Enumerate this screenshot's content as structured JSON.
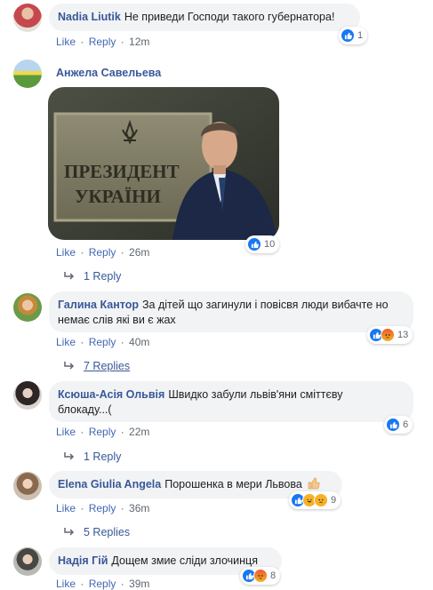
{
  "comments": [
    {
      "author": "Nadia Liutik",
      "text": "Не приведи Господи такого губернатора!",
      "actions": {
        "like": "Like",
        "reply": "Reply",
        "time": "12m"
      },
      "reaction_count": "1"
    },
    {
      "author": "Анжела Савельева",
      "image_text_line1": "ПРЕЗИДЕНТ",
      "image_text_line2": "УКРАЇНИ",
      "actions": {
        "like": "Like",
        "reply": "Reply",
        "time": "26m"
      },
      "reaction_count": "10",
      "replies_label": "1 Reply"
    },
    {
      "author": "Галина Кантор",
      "text": "За дітей що загинули і повісвя люди вибачте но немає слів які ви є жах",
      "actions": {
        "like": "Like",
        "reply": "Reply",
        "time": "40m"
      },
      "reaction_count": "13",
      "replies_label": "7 Replies"
    },
    {
      "author": "Ксюша-Асія Ольвія",
      "text": "Швидко забули львів'яни сміттєву блокаду...(",
      "actions": {
        "like": "Like",
        "reply": "Reply",
        "time": "22m"
      },
      "reaction_count": "6",
      "replies_label": "1 Reply"
    },
    {
      "author": "Elena Giulia Angela",
      "text": "Порошенка в мери Львова",
      "actions": {
        "like": "Like",
        "reply": "Reply",
        "time": "36m"
      },
      "reaction_count": "9",
      "replies_label": "5 Replies"
    },
    {
      "author": "Надія Гій",
      "text": "Дощем змие сліди злочинця",
      "actions": {
        "like": "Like",
        "reply": "Reply",
        "time": "39m"
      },
      "reaction_count": "8"
    }
  ],
  "colors": {
    "link": "#385898",
    "action_link": "#4267b2",
    "bubble": "#f2f3f5",
    "like_blue": "#1877f2"
  }
}
